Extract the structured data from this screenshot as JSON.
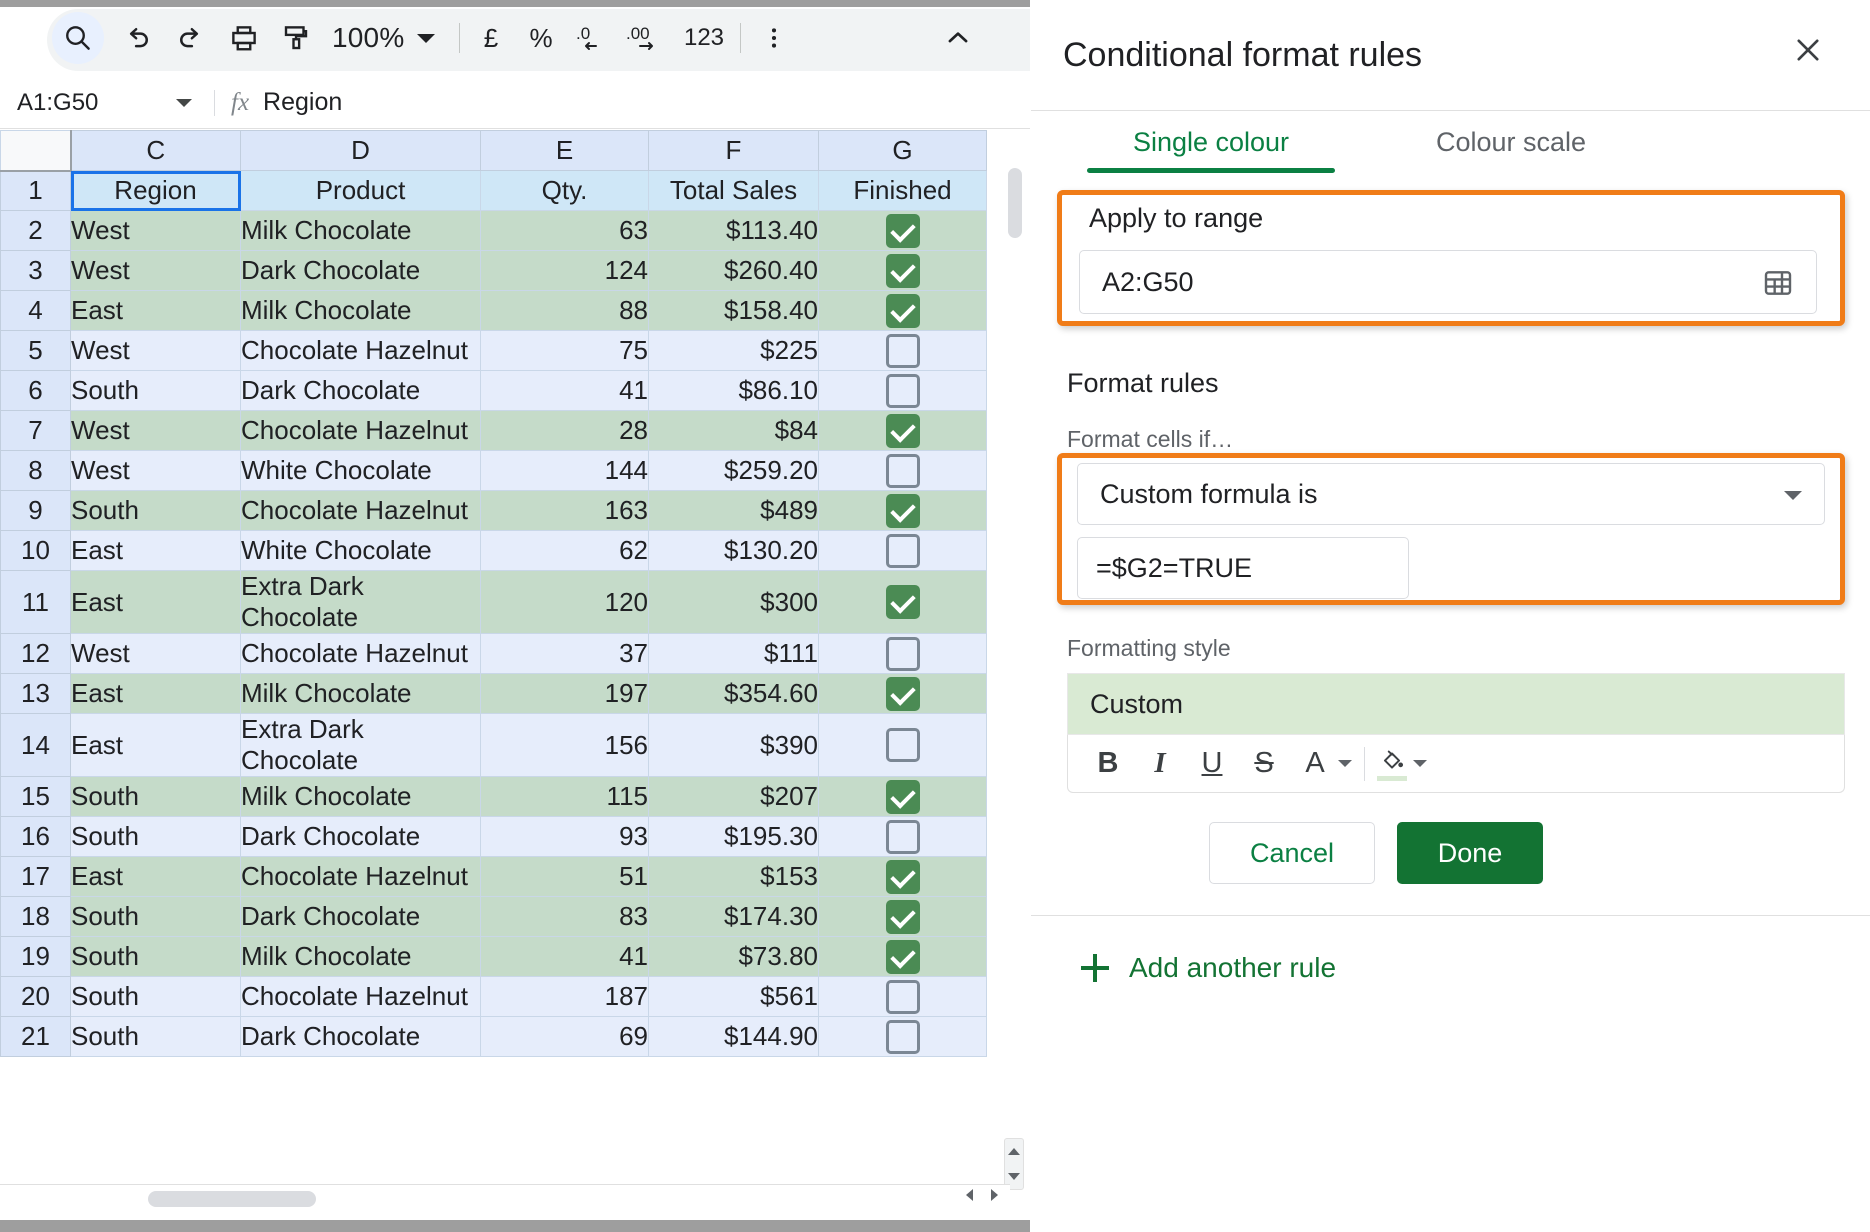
{
  "toolbar": {
    "search_label": "search-icon",
    "undo_label": "undo-icon",
    "redo_label": "redo-icon",
    "print_label": "print-icon",
    "paint_format_label": "paint-format-icon",
    "zoom_value": "100%",
    "currency_label": "£",
    "percent_label": "%",
    "decrease_decimal_label": ".0",
    "increase_decimal_label": ".00",
    "more_formats_label": "123",
    "more_label": "more-options-icon",
    "collapse_label": "collapse-toolbar-icon"
  },
  "formula_bar": {
    "name_box": "A1:G50",
    "fx_label": "fx",
    "value": "Region"
  },
  "sheet": {
    "column_letters": [
      "",
      "C",
      "D",
      "E",
      "F",
      "G"
    ],
    "header_row_number": "1",
    "headers": [
      "Region",
      "Product",
      "Qty.",
      "Total Sales",
      "Finished"
    ],
    "selected_header": "Region",
    "rows": [
      {
        "n": "2",
        "region": "West",
        "product": "Milk Chocolate",
        "qty": "63",
        "sales": "$113.40",
        "finished": true
      },
      {
        "n": "3",
        "region": "West",
        "product": "Dark Chocolate",
        "qty": "124",
        "sales": "$260.40",
        "finished": true
      },
      {
        "n": "4",
        "region": "East",
        "product": "Milk Chocolate",
        "qty": "88",
        "sales": "$158.40",
        "finished": true
      },
      {
        "n": "5",
        "region": "West",
        "product": "Chocolate Hazelnut",
        "qty": "75",
        "sales": "$225",
        "finished": false
      },
      {
        "n": "6",
        "region": "South",
        "product": "Dark Chocolate",
        "qty": "41",
        "sales": "$86.10",
        "finished": false
      },
      {
        "n": "7",
        "region": "West",
        "product": "Chocolate Hazelnut",
        "qty": "28",
        "sales": "$84",
        "finished": true
      },
      {
        "n": "8",
        "region": "West",
        "product": "White Chocolate",
        "qty": "144",
        "sales": "$259.20",
        "finished": false
      },
      {
        "n": "9",
        "region": "South",
        "product": "Chocolate Hazelnut",
        "qty": "163",
        "sales": "$489",
        "finished": true
      },
      {
        "n": "10",
        "region": "East",
        "product": "White Chocolate",
        "qty": "62",
        "sales": "$130.20",
        "finished": false
      },
      {
        "n": "11",
        "region": "East",
        "product": "Extra Dark Chocolate",
        "qty": "120",
        "sales": "$300",
        "finished": true
      },
      {
        "n": "12",
        "region": "West",
        "product": "Chocolate Hazelnut",
        "qty": "37",
        "sales": "$111",
        "finished": false
      },
      {
        "n": "13",
        "region": "East",
        "product": "Milk Chocolate",
        "qty": "197",
        "sales": "$354.60",
        "finished": true
      },
      {
        "n": "14",
        "region": "East",
        "product": "Extra Dark Chocolate",
        "qty": "156",
        "sales": "$390",
        "finished": false
      },
      {
        "n": "15",
        "region": "South",
        "product": "Milk Chocolate",
        "qty": "115",
        "sales": "$207",
        "finished": true
      },
      {
        "n": "16",
        "region": "South",
        "product": "Dark Chocolate",
        "qty": "93",
        "sales": "$195.30",
        "finished": false
      },
      {
        "n": "17",
        "region": "East",
        "product": "Chocolate Hazelnut",
        "qty": "51",
        "sales": "$153",
        "finished": true
      },
      {
        "n": "18",
        "region": "South",
        "product": "Dark Chocolate",
        "qty": "83",
        "sales": "$174.30",
        "finished": true
      },
      {
        "n": "19",
        "region": "South",
        "product": "Milk Chocolate",
        "qty": "41",
        "sales": "$73.80",
        "finished": true
      },
      {
        "n": "20",
        "region": "South",
        "product": "Chocolate Hazelnut",
        "qty": "187",
        "sales": "$561",
        "finished": false
      },
      {
        "n": "21",
        "region": "South",
        "product": "Dark Chocolate",
        "qty": "69",
        "sales": "$144.90",
        "finished": false
      }
    ]
  },
  "panel": {
    "title": "Conditional format rules",
    "close_label": "close-icon",
    "tabs": [
      {
        "label": "Single colour",
        "selected": true
      },
      {
        "label": "Colour scale",
        "selected": false
      }
    ],
    "apply_to_range_label": "Apply to range",
    "range_value": "A2:G50",
    "range_picker_label": "select-range-icon",
    "format_rules_label": "Format rules",
    "format_cells_if_label": "Format cells if…",
    "condition_value": "Custom formula is",
    "formula_value": "=$G2=TRUE",
    "formatting_style_label": "Formatting style",
    "style_preview_label": "Custom",
    "style_buttons": {
      "bold": "B",
      "italic": "I",
      "underline": "U",
      "strikethrough": "S",
      "text_colour": "A",
      "fill_colour": "fill-colour-icon"
    },
    "cancel_label": "Cancel",
    "done_label": "Done",
    "add_rule_label": "Add another rule"
  },
  "colors": {
    "accent_green": "#0b8043",
    "done_green": "#137333",
    "highlight_orange": "#f07c18",
    "row_highlight": "#c5dbc9",
    "row_default": "#e6edfb",
    "header_blue": "#cfe7f7",
    "style_preview_fill": "#d9ead3"
  }
}
